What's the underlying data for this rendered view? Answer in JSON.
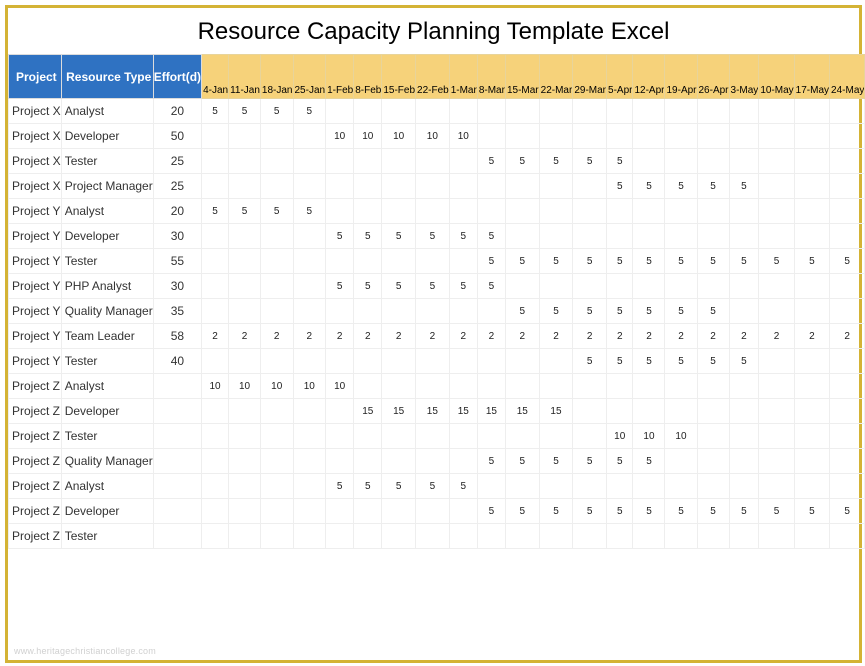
{
  "title": "Resource Capacity Planning Template Excel",
  "watermark": "www.heritagechristiancollege.com",
  "headers": {
    "project": "Project",
    "resourceType": "Resource Type",
    "effort": "Effort(d)"
  },
  "dates": [
    "4-Jan",
    "11-Jan",
    "18-Jan",
    "25-Jan",
    "1-Feb",
    "8-Feb",
    "15-Feb",
    "22-Feb",
    "1-Mar",
    "8-Mar",
    "15-Mar",
    "22-Mar",
    "29-Mar",
    "5-Apr",
    "12-Apr",
    "19-Apr",
    "26-Apr",
    "3-May",
    "10-May",
    "17-May",
    "24-May"
  ],
  "rows": [
    {
      "project": "Project X",
      "resourceType": "Analyst",
      "effort": "20",
      "cells": [
        "5",
        "5",
        "5",
        "5",
        "",
        "",
        "",
        "",
        "",
        "",
        "",
        "",
        "",
        "",
        "",
        "",
        "",
        "",
        "",
        "",
        ""
      ]
    },
    {
      "project": "Project X",
      "resourceType": "Developer",
      "effort": "50",
      "cells": [
        "",
        "",
        "",
        "",
        "10",
        "10",
        "10",
        "10",
        "10",
        "",
        "",
        "",
        "",
        "",
        "",
        "",
        "",
        "",
        "",
        "",
        ""
      ]
    },
    {
      "project": "Project X",
      "resourceType": "Tester",
      "effort": "25",
      "cells": [
        "",
        "",
        "",
        "",
        "",
        "",
        "",
        "",
        "",
        "5",
        "5",
        "5",
        "5",
        "5",
        "",
        "",
        "",
        "",
        "",
        "",
        ""
      ]
    },
    {
      "project": "Project X",
      "resourceType": "Project Manager",
      "effort": "25",
      "cells": [
        "",
        "",
        "",
        "",
        "",
        "",
        "",
        "",
        "",
        "",
        "",
        "",
        "",
        "5",
        "5",
        "5",
        "5",
        "5",
        "",
        "",
        ""
      ]
    },
    {
      "project": "Project Y",
      "resourceType": "Analyst",
      "effort": "20",
      "cells": [
        "5",
        "5",
        "5",
        "5",
        "",
        "",
        "",
        "",
        "",
        "",
        "",
        "",
        "",
        "",
        "",
        "",
        "",
        "",
        "",
        "",
        ""
      ]
    },
    {
      "project": "Project Y",
      "resourceType": "Developer",
      "effort": "30",
      "cells": [
        "",
        "",
        "",
        "",
        "5",
        "5",
        "5",
        "5",
        "5",
        "5",
        "",
        "",
        "",
        "",
        "",
        "",
        "",
        "",
        "",
        "",
        ""
      ]
    },
    {
      "project": "Project Y",
      "resourceType": "Tester",
      "effort": "55",
      "cells": [
        "",
        "",
        "",
        "",
        "",
        "",
        "",
        "",
        "",
        "5",
        "5",
        "5",
        "5",
        "5",
        "5",
        "5",
        "5",
        "5",
        "5",
        "5",
        "5"
      ]
    },
    {
      "project": "Project Y",
      "resourceType": "PHP Analyst",
      "effort": "30",
      "cells": [
        "",
        "",
        "",
        "",
        "5",
        "5",
        "5",
        "5",
        "5",
        "5",
        "",
        "",
        "",
        "",
        "",
        "",
        "",
        "",
        "",
        "",
        ""
      ]
    },
    {
      "project": "Project Y",
      "resourceType": "Quality Manager",
      "effort": "35",
      "cells": [
        "",
        "",
        "",
        "",
        "",
        "",
        "",
        "",
        "",
        "",
        "5",
        "5",
        "5",
        "5",
        "5",
        "5",
        "5",
        "",
        "",
        "",
        ""
      ]
    },
    {
      "project": "Project Y",
      "resourceType": "Team Leader",
      "effort": "58",
      "cells": [
        "2",
        "2",
        "2",
        "2",
        "2",
        "2",
        "2",
        "2",
        "2",
        "2",
        "2",
        "2",
        "2",
        "2",
        "2",
        "2",
        "2",
        "2",
        "2",
        "2",
        "2"
      ]
    },
    {
      "project": "Project Y",
      "resourceType": "Tester",
      "effort": "40",
      "cells": [
        "",
        "",
        "",
        "",
        "",
        "",
        "",
        "",
        "",
        "",
        "",
        "",
        "5",
        "5",
        "5",
        "5",
        "5",
        "5",
        "",
        "",
        ""
      ]
    },
    {
      "project": "Project Z",
      "resourceType": "Analyst",
      "effort": "",
      "cells": [
        "10",
        "10",
        "10",
        "10",
        "10",
        "",
        "",
        "",
        "",
        "",
        "",
        "",
        "",
        "",
        "",
        "",
        "",
        "",
        "",
        "",
        ""
      ]
    },
    {
      "project": "Project Z",
      "resourceType": "Developer",
      "effort": "",
      "cells": [
        "",
        "",
        "",
        "",
        "",
        "15",
        "15",
        "15",
        "15",
        "15",
        "15",
        "15",
        "",
        "",
        "",
        "",
        "",
        "",
        "",
        "",
        ""
      ]
    },
    {
      "project": "Project Z",
      "resourceType": "Tester",
      "effort": "",
      "cells": [
        "",
        "",
        "",
        "",
        "",
        "",
        "",
        "",
        "",
        "",
        "",
        "",
        "",
        "10",
        "10",
        "10",
        "",
        "",
        "",
        "",
        ""
      ]
    },
    {
      "project": "Project Z",
      "resourceType": "Quality Manager",
      "effort": "",
      "cells": [
        "",
        "",
        "",
        "",
        "",
        "",
        "",
        "",
        "",
        "5",
        "5",
        "5",
        "5",
        "5",
        "5",
        "",
        "",
        "",
        "",
        "",
        ""
      ]
    },
    {
      "project": "Project Z",
      "resourceType": "Analyst",
      "effort": "",
      "cells": [
        "",
        "",
        "",
        "",
        "5",
        "5",
        "5",
        "5",
        "5",
        "",
        "",
        "",
        "",
        "",
        "",
        "",
        "",
        "",
        "",
        "",
        ""
      ]
    },
    {
      "project": "Project Z",
      "resourceType": "Developer",
      "effort": "",
      "cells": [
        "",
        "",
        "",
        "",
        "",
        "",
        "",
        "",
        "",
        "5",
        "5",
        "5",
        "5",
        "5",
        "5",
        "5",
        "5",
        "5",
        "5",
        "5",
        "5"
      ]
    },
    {
      "project": "Project Z",
      "resourceType": "Tester",
      "effort": "",
      "cells": [
        "",
        "",
        "",
        "",
        "",
        "",
        "",
        "",
        "",
        "",
        "",
        "",
        "",
        "",
        "",
        "",
        "",
        "",
        "",
        "",
        ""
      ]
    }
  ]
}
